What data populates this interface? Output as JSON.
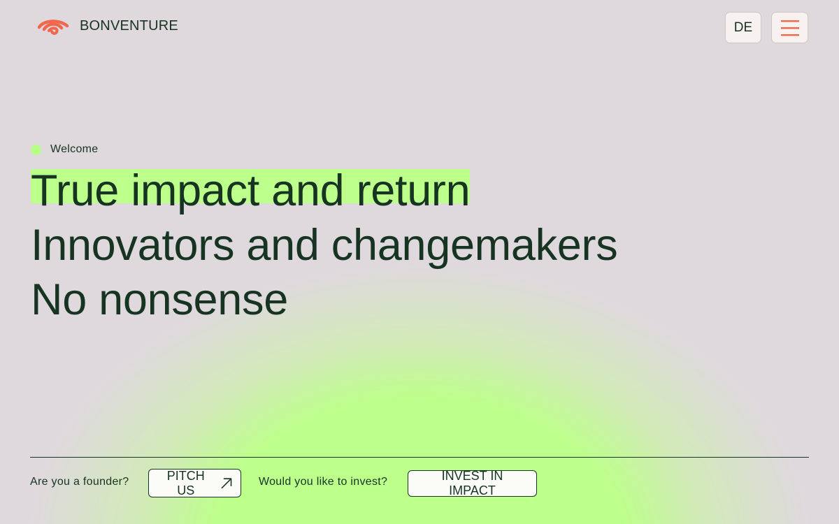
{
  "header": {
    "brand": "BONVENTURE",
    "lang_label": "DE",
    "icons": {
      "logo": "bonventure-swirl-logo",
      "menu": "hamburger-menu-icon"
    }
  },
  "hero": {
    "eyebrow": "Welcome",
    "lines": [
      "True impact and return",
      "Innovators and changemakers",
      "No nonsense"
    ]
  },
  "cta": {
    "founder_prompt": "Are you a founder?",
    "pitch_label": "PITCH US",
    "investor_prompt": "Would you like to invest?",
    "invest_label": "INVEST IN IMPACT"
  },
  "colors": {
    "background": "#dfd9de",
    "accent_green": "#bcff8a",
    "logo_orange": "#f0674b",
    "text_dark": "#173322"
  }
}
